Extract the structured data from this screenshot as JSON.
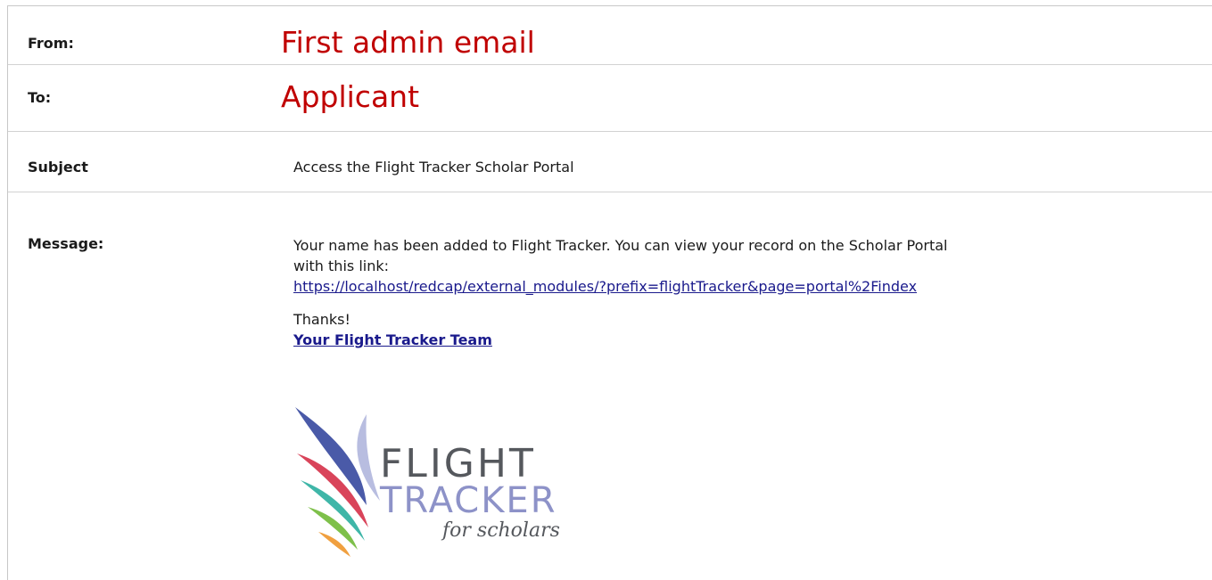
{
  "from": {
    "label": "From:",
    "annotation": "First admin email"
  },
  "to": {
    "label": "To:",
    "annotation": "Applicant"
  },
  "subject": {
    "label": "Subject",
    "value": "Access the Flight Tracker Scholar Portal"
  },
  "message": {
    "label": "Message:",
    "line1": "Your name has been added to Flight Tracker. You can view your record on the Scholar Portal",
    "line2": "with this link:",
    "link": "https://localhost/redcap/external_modules/?prefix=flightTracker&page=portal%2Findex",
    "thanks": "Thanks!",
    "signature": "Your Flight Tracker Team"
  },
  "logo": {
    "word1": "FLIGHT",
    "word2": "TRACKER",
    "tagline": "for scholars",
    "colors": {
      "text_dark": "#55585d",
      "text_light": "#8d92c8",
      "stripe_blue": "#4a5aa8",
      "stripe_lavender": "#b8bde0",
      "stripe_red": "#d9445a",
      "stripe_teal": "#3fb6a8",
      "stripe_green": "#7ec04a",
      "stripe_orange": "#f0a040"
    }
  },
  "colors": {
    "annotation": "#c00000",
    "link": "#1a1a8c"
  }
}
